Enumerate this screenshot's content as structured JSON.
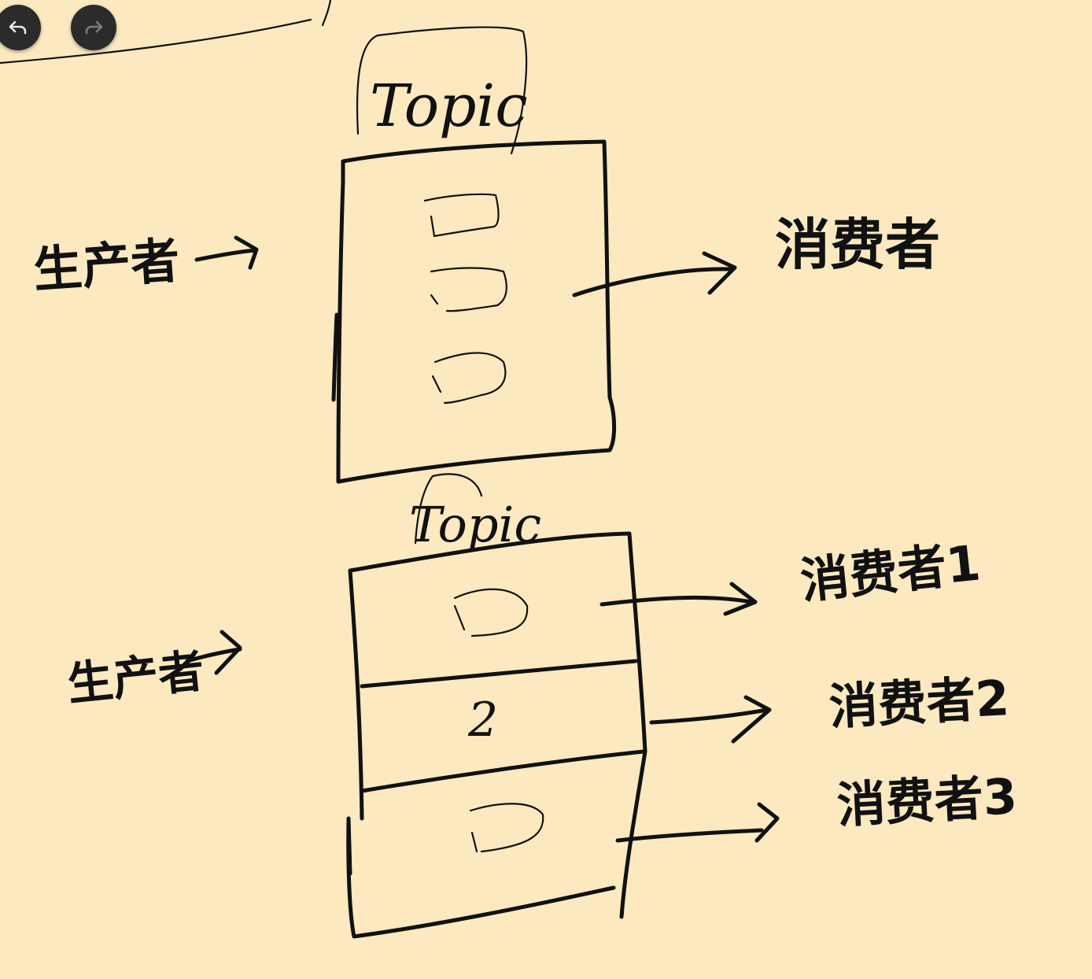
{
  "toolbar": {
    "undo_icon": "undo-arrow-icon",
    "redo_icon": "redo-arrow-icon"
  },
  "diagram_top": {
    "topic_label": "Topic",
    "producer_label": "生产者",
    "consumer_label": "消费者",
    "messages": [
      "",
      "",
      ""
    ]
  },
  "diagram_bottom": {
    "topic_label": "Topic",
    "producer_label": "生产者",
    "partitions": [
      "",
      "2",
      ""
    ],
    "consumers": [
      "消费者1",
      "消费者2",
      "消费者3"
    ]
  },
  "colors": {
    "paper": "#FCE9C0",
    "ink": "#111111",
    "button": "#2B2B2B"
  }
}
